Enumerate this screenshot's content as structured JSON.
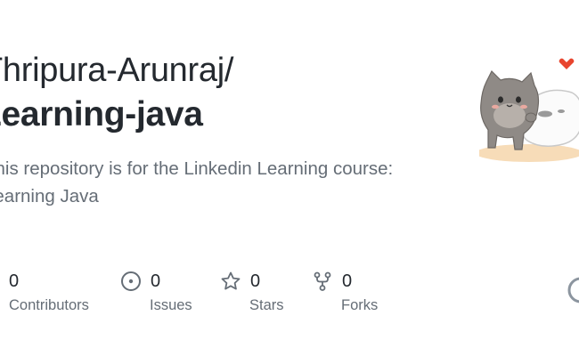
{
  "repo_card": {
    "owner": "Thripura-Arunraj/",
    "name": "Learning-java",
    "description": "This repository is for the Linkedin Learning course: Learning Java"
  },
  "stats": {
    "contributors": {
      "count": "0",
      "label": "Contributors",
      "icon": "people-icon"
    },
    "issues": {
      "count": "0",
      "label": "Issues",
      "icon": "issue-icon"
    },
    "stars": {
      "count": "0",
      "label": "Stars",
      "icon": "star-icon"
    },
    "forks": {
      "count": "0",
      "label": "Forks",
      "icon": "fork-icon"
    }
  },
  "colors": {
    "text_primary": "#24292f",
    "text_secondary": "#656d76",
    "background": "#ffffff"
  }
}
